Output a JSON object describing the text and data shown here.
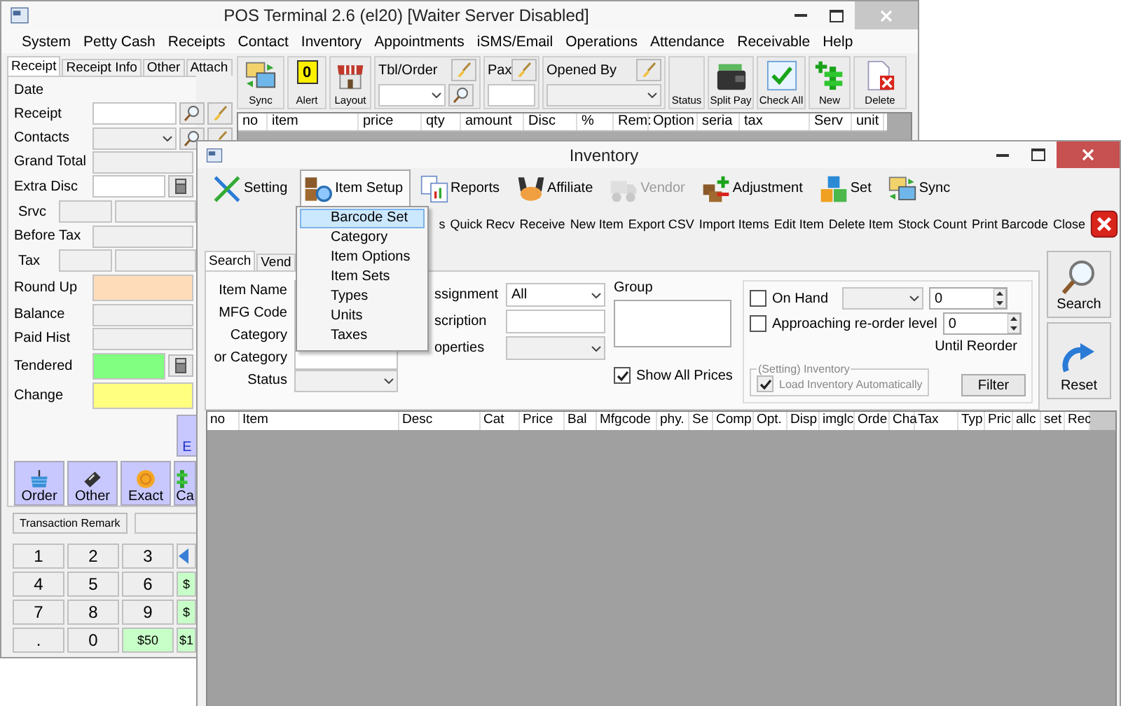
{
  "pos_window": {
    "title": "POS Terminal 2.6 (el20) [Waiter Server Disabled]",
    "menu": [
      "System",
      "Petty Cash",
      "Receipts",
      "Contact",
      "Inventory",
      "Appointments",
      "iSMS/Email",
      "Operations",
      "Attendance",
      "Receivable",
      "Help"
    ],
    "tabs": [
      {
        "label": "Receipt",
        "selected": true
      },
      {
        "label": "Receipt Info",
        "selected": false
      },
      {
        "label": "Other",
        "selected": false
      },
      {
        "label": "Attach",
        "selected": false
      }
    ],
    "fields": [
      {
        "label": "Date",
        "kind": "label"
      },
      {
        "label": "Receipt",
        "kind": "lookup"
      },
      {
        "label": "Contacts",
        "kind": "lookup_select"
      },
      {
        "label": "Grand Total",
        "kind": "readonly"
      },
      {
        "label": "Extra Disc",
        "kind": "calc"
      },
      {
        "label": "Srvc",
        "kind": "split"
      },
      {
        "label": "Before Tax",
        "kind": "readonly"
      },
      {
        "label": "Tax",
        "kind": "split"
      },
      {
        "label": "Round Up",
        "kind": "colored",
        "color": "#ffdcb9"
      },
      {
        "label": "Balance",
        "kind": "readonly"
      },
      {
        "label": "Paid Hist",
        "kind": "readonly"
      },
      {
        "label": "Tendered",
        "kind": "colored_calc",
        "color": "#80ff80"
      },
      {
        "label": "Change",
        "kind": "colored",
        "color": "#ffff80"
      }
    ],
    "side_button": {
      "label": "E"
    },
    "pay_buttons": [
      {
        "label": "Order",
        "kind": "basket"
      },
      {
        "label": "Other",
        "kind": "card"
      },
      {
        "label": "Exact",
        "kind": "coin"
      },
      {
        "label": "Ca",
        "kind": "cash"
      }
    ],
    "remark_button": "Transaction Remark",
    "keypad": [
      {
        "label": "1",
        "kind": "digit"
      },
      {
        "label": "2",
        "kind": "digit"
      },
      {
        "label": "3",
        "kind": "digit"
      },
      {
        "kind": "back"
      },
      {
        "label": "4",
        "kind": "digit"
      },
      {
        "label": "5",
        "kind": "digit"
      },
      {
        "label": "6",
        "kind": "digit"
      },
      {
        "label": "$",
        "kind": "money"
      },
      {
        "label": "7",
        "kind": "digit"
      },
      {
        "label": "8",
        "kind": "digit"
      },
      {
        "label": "9",
        "kind": "digit"
      },
      {
        "label": "$",
        "kind": "money"
      },
      {
        "label": ".",
        "kind": "digit"
      },
      {
        "label": "0",
        "kind": "digit"
      },
      {
        "label": "$50",
        "kind": "money"
      },
      {
        "label": "$1",
        "kind": "money"
      }
    ],
    "toolbar": [
      {
        "kind": "sync",
        "label": "Sync"
      },
      {
        "kind": "alert",
        "label": "Alert",
        "badge": "0"
      },
      {
        "kind": "layout",
        "label": "Layout"
      },
      {
        "kind": "group_select_search",
        "label": "Tbl/Order"
      },
      {
        "kind": "group_input",
        "label": "Pax"
      },
      {
        "kind": "group_select",
        "label": "Opened By"
      },
      {
        "kind": "plain",
        "label": "Status"
      },
      {
        "kind": "splitpay",
        "label": "Split Pay"
      },
      {
        "kind": "checkall",
        "label": "Check All"
      },
      {
        "kind": "new",
        "label": "New"
      },
      {
        "kind": "delete",
        "label": "Delete"
      }
    ],
    "table": {
      "columns": [
        "no",
        "item",
        "price",
        "qty",
        "amount",
        "Disc",
        "%",
        "Rem:",
        "Option",
        "seria",
        "tax",
        "Serv",
        "unit"
      ]
    }
  },
  "inventory_window": {
    "title": "Inventory",
    "toolbar": [
      {
        "kind": "setting",
        "label": "Setting",
        "pressed": false,
        "disabled": false
      },
      {
        "kind": "item_setup",
        "label": "Item Setup",
        "pressed": true,
        "disabled": false
      },
      {
        "kind": "reports",
        "label": "Reports",
        "pressed": false,
        "disabled": false
      },
      {
        "kind": "affiliate",
        "label": "Affiliate",
        "pressed": false,
        "disabled": false
      },
      {
        "kind": "vendor",
        "label": "Vendor",
        "pressed": false,
        "disabled": true
      },
      {
        "kind": "adjustment",
        "label": "Adjustment",
        "pressed": false,
        "disabled": false
      },
      {
        "kind": "set",
        "label": "Set",
        "pressed": false,
        "disabled": false
      },
      {
        "kind": "sync",
        "label": "Sync",
        "pressed": false,
        "disabled": false
      }
    ],
    "actions": [
      "s",
      "Quick Recv",
      "Receive",
      "New Item",
      "Export CSV",
      "Import Items",
      "Edit Item",
      "Delete Item",
      "Stock Count",
      "Print Barcode",
      "Close"
    ],
    "item_setup_menu": [
      {
        "label": "Barcode Set",
        "selected": true
      },
      {
        "label": "Category",
        "selected": false
      },
      {
        "label": "Item Options",
        "selected": false
      },
      {
        "label": "Item Sets",
        "selected": false
      },
      {
        "label": "Types",
        "selected": false
      },
      {
        "label": "Units",
        "selected": false
      },
      {
        "label": "Taxes",
        "selected": false
      }
    ],
    "search_tabs": [
      {
        "label": "Search",
        "selected": true
      },
      {
        "label": "Vend",
        "selected": false
      }
    ],
    "search_fields": [
      {
        "label": "Item Name",
        "kind": "input"
      },
      {
        "label": "MFG Code",
        "kind": "input"
      },
      {
        "label": "Category",
        "kind": "input"
      },
      {
        "label": "or Category",
        "kind": "input"
      },
      {
        "label": "Status",
        "kind": "select"
      }
    ],
    "filter_fields": [
      {
        "label": "ssignment",
        "kind": "select",
        "value": "All"
      },
      {
        "label": "scription",
        "kind": "input"
      },
      {
        "label": "operties",
        "kind": "select"
      }
    ],
    "group": {
      "label": "Group"
    },
    "show_all_prices": {
      "label": "Show All Prices",
      "checked": true
    },
    "on_hand": {
      "label": "On Hand",
      "checked": false,
      "value": "0"
    },
    "reorder": {
      "label": "Approaching re-order level",
      "checked": false,
      "value": "0",
      "caption": "Until Reorder"
    },
    "inventory_setting": {
      "title": "(Setting) Inventory",
      "label": "Load Inventory Automatically",
      "checked": true,
      "disabled": true
    },
    "filter_button": "Filter",
    "search_button": "Search",
    "reset_button": "Reset",
    "table": {
      "columns": [
        "no",
        "Item",
        "Desc",
        "Cat",
        "Price",
        "Bal",
        "Mfgcode",
        "phy.",
        "Se",
        "Comp",
        "Opt.",
        "Disp",
        "imglc",
        "Orde",
        "Cha",
        "Tax",
        "Typ",
        "Pric",
        "allc",
        "set",
        "Rec"
      ]
    }
  }
}
